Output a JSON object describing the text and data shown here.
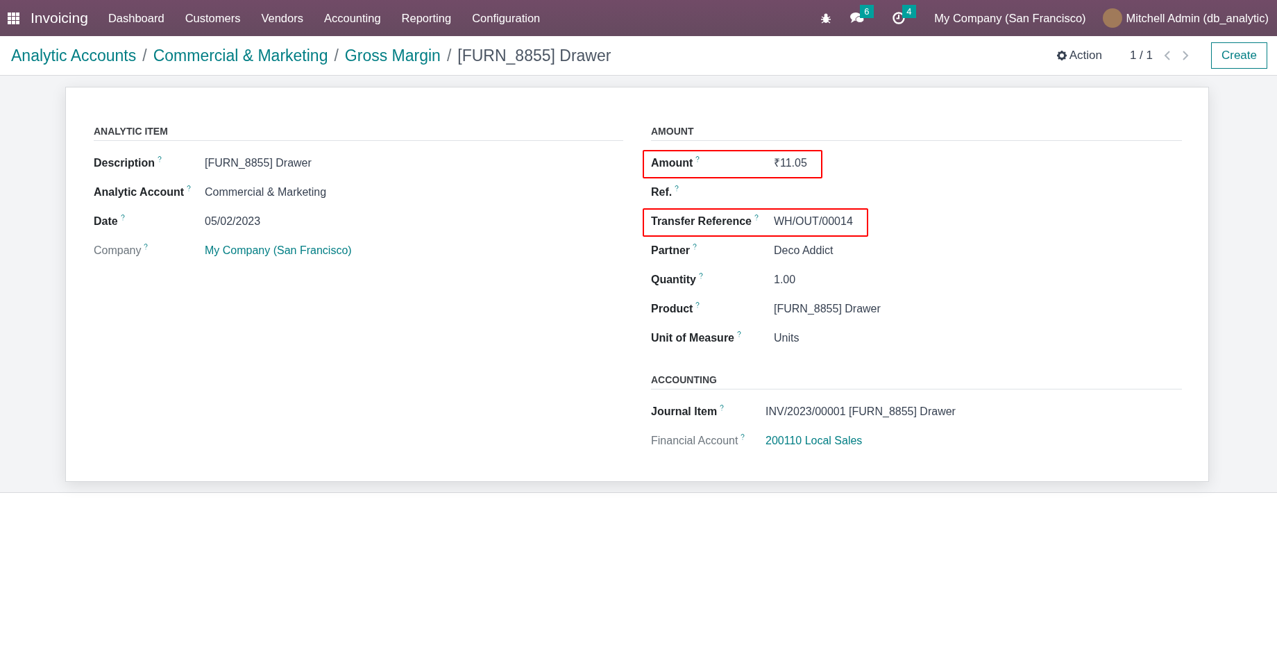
{
  "navbar": {
    "app_name": "Invoicing",
    "menu": [
      "Dashboard",
      "Customers",
      "Vendors",
      "Accounting",
      "Reporting",
      "Configuration"
    ],
    "messages_count": "6",
    "activities_count": "4",
    "company": "My Company (San Francisco)",
    "user": "Mitchell Admin (db_analytic)"
  },
  "breadcrumbs": [
    {
      "label": "Analytic Accounts",
      "link": true
    },
    {
      "separator": "/",
      "label": "Commercial & Marketing",
      "link": true
    },
    {
      "separator": "/",
      "label": "Gross Margin",
      "link": true
    },
    {
      "separator": "/",
      "label": "[FURN_8855] Drawer",
      "link": false
    }
  ],
  "control_panel": {
    "action": "Action",
    "pager": "1 / 1",
    "create": "Create"
  },
  "groups": [
    {
      "title": "ANALYTIC ITEM",
      "fields": [
        {
          "label": "Description",
          "value": "[FURN_8855] Drawer",
          "muted": false,
          "link": false,
          "highlighted": false
        },
        {
          "label": "Analytic Account",
          "value": "Commercial & Marketing",
          "muted": false,
          "link": false,
          "highlighted": false
        },
        {
          "label": "Date",
          "value": "05/02/2023",
          "muted": false,
          "link": false,
          "highlighted": false
        },
        {
          "label": "Company",
          "value": "My Company (San Francisco)",
          "muted": true,
          "link": true,
          "highlighted": false
        }
      ]
    },
    {
      "title": "AMOUNT",
      "fields": [
        {
          "label": "Amount",
          "value": "₹11.05",
          "muted": false,
          "link": false,
          "highlighted": true
        },
        {
          "label": "Ref.",
          "muted": false,
          "highlighted": false
        },
        {
          "label": "Transfer Reference",
          "value": "WH/OUT/00014",
          "muted": false,
          "link": false,
          "highlighted": true
        },
        {
          "label": "Partner",
          "value": "Deco Addict",
          "muted": false,
          "link": false,
          "highlighted": false
        },
        {
          "label": "Quantity",
          "value": "1.00",
          "muted": false,
          "link": false,
          "highlighted": false
        },
        {
          "label": "Product",
          "value": "[FURN_8855] Drawer",
          "muted": false,
          "link": false,
          "highlighted": false
        },
        {
          "label": "Unit of Measure",
          "value": "Units",
          "muted": false,
          "link": false,
          "highlighted": false
        }
      ]
    },
    {
      "title": "ACCOUNTING",
      "fields": [
        {
          "label": "Journal Item",
          "value": "INV/2023/00001 [FURN_8855] Drawer",
          "muted": false,
          "link": false,
          "highlighted": false
        },
        {
          "label": "Financial Account",
          "value": "200110 Local Sales",
          "muted": true,
          "link": true,
          "highlighted": false
        }
      ]
    }
  ]
}
